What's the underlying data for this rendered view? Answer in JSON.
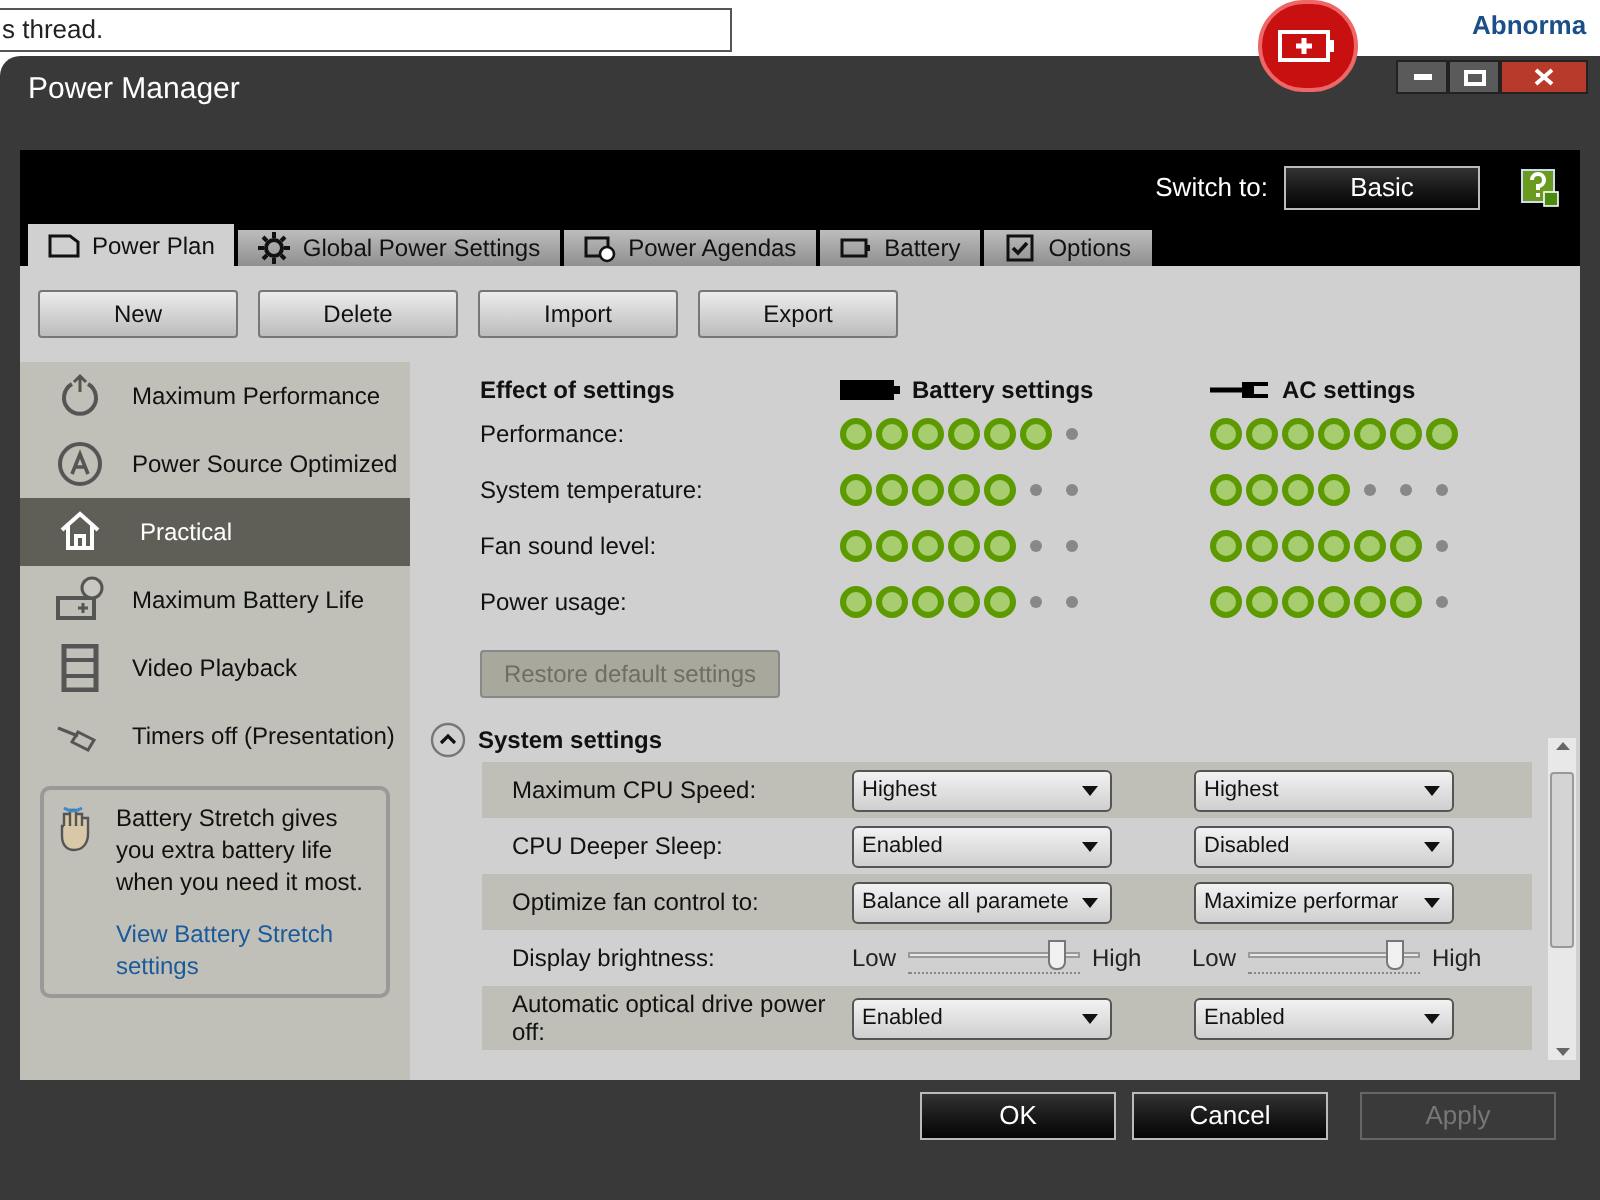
{
  "background": {
    "thread_text": "s thread.",
    "author_link": "Abnorma"
  },
  "window": {
    "title": "Power Manager"
  },
  "switch_to": {
    "label": "Switch to:",
    "button": "Basic"
  },
  "tabs": [
    {
      "label": "Power Plan",
      "selected": true
    },
    {
      "label": "Global Power Settings",
      "selected": false
    },
    {
      "label": "Power Agendas",
      "selected": false
    },
    {
      "label": "Battery",
      "selected": false
    },
    {
      "label": "Options",
      "selected": false
    }
  ],
  "toolbar": [
    "New",
    "Delete",
    "Import",
    "Export"
  ],
  "plans": [
    {
      "label": "Maximum Performance",
      "selected": false
    },
    {
      "label": "Power Source Optimized",
      "selected": false
    },
    {
      "label": "Practical",
      "selected": true
    },
    {
      "label": "Maximum Battery Life",
      "selected": false
    },
    {
      "label": "Video Playback",
      "selected": false
    },
    {
      "label": "Timers off (Presentation)",
      "selected": false
    }
  ],
  "tip": {
    "text": "Battery Stretch gives you extra battery life when you need it most.",
    "link": "View Battery Stretch settings"
  },
  "effect": {
    "heading": "Effect of settings",
    "battery_heading": "Battery settings",
    "ac_heading": "AC settings",
    "rows": [
      {
        "label": "Performance:",
        "battery": {
          "stars": 6
        },
        "ac": {
          "stars": 7
        }
      },
      {
        "label": "System temperature:",
        "battery": {
          "stars": 5
        },
        "ac": {
          "stars": 4
        }
      },
      {
        "label": "Fan sound level:",
        "battery": {
          "stars": 5
        },
        "ac": {
          "stars": 6
        }
      },
      {
        "label": "Power usage:",
        "battery": {
          "stars": 5
        },
        "ac": {
          "stars": 6
        }
      }
    ]
  },
  "restore_button": {
    "label": "Restore default settings",
    "disabled": true
  },
  "system_settings": {
    "title": "System settings",
    "expanded": true,
    "rows": [
      {
        "kind": "select",
        "label": "Maximum CPU Speed:",
        "battery": {
          "value": "Highest"
        },
        "ac": {
          "value": "Highest"
        }
      },
      {
        "kind": "select",
        "label": "CPU Deeper Sleep:",
        "battery": {
          "value": "Enabled"
        },
        "ac": {
          "value": "Disabled"
        }
      },
      {
        "kind": "select",
        "label": "Optimize fan control to:",
        "battery": {
          "value": "Balance all paramete"
        },
        "ac": {
          "value": "Maximize performar"
        }
      },
      {
        "kind": "slider",
        "label": "Display brightness:",
        "battery": {
          "low": "Low",
          "high": "High",
          "level": 0.87
        },
        "ac": {
          "low": "Low",
          "high": "High",
          "level": 0.86
        }
      },
      {
        "kind": "select",
        "label": "Automatic optical drive power off:",
        "battery": {
          "value": "Enabled"
        },
        "ac": {
          "value": "Enabled"
        }
      }
    ]
  },
  "footer": [
    {
      "label": "OK",
      "disabled": false
    },
    {
      "label": "Cancel",
      "disabled": false
    },
    {
      "label": "Apply",
      "disabled": true
    }
  ]
}
